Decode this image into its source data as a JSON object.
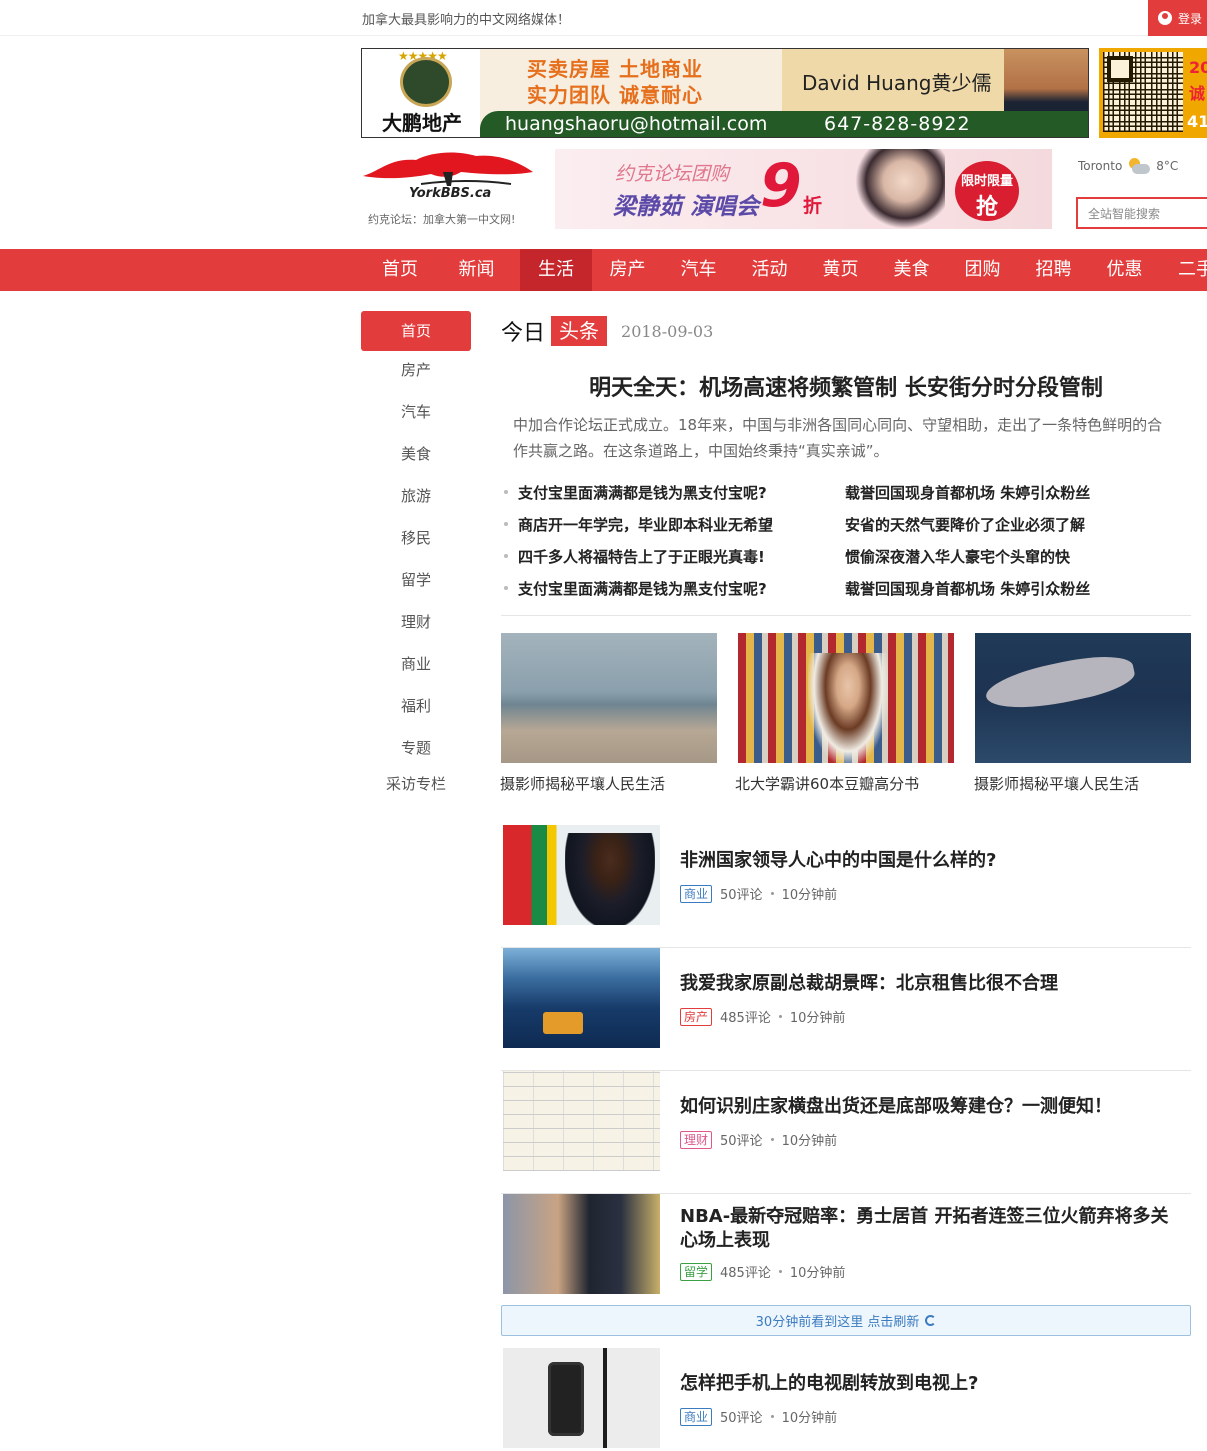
{
  "topbar": {
    "slogan": "加拿大最具影响力的中文网络媒体！",
    "login": "登录"
  },
  "banner_ad": {
    "brand": "大鹏地产",
    "slogan_line1": "买卖房屋 土地商业",
    "slogan_line2": "实力团队 诚意耐心",
    "agent": "David Huang黄少儒",
    "email": "huangshaoru@hotmail.com",
    "phone": "647-828-8922"
  },
  "side_ad": {
    "line1": "20",
    "line2": "诚",
    "line3": "41"
  },
  "site": {
    "tagline": "约克论坛：加拿大第一中文网!",
    "wordmark": "YorkBBS.ca"
  },
  "promo": {
    "line1": "约克论坛团购",
    "line2": "梁静茹 演唱会",
    "discount": "9",
    "discount_unit": "折",
    "badge_top": "限时限量",
    "badge_bottom": "抢"
  },
  "weather": {
    "city": "Toronto",
    "temp": "8°C"
  },
  "search": {
    "placeholder": "全站智能搜索"
  },
  "nav": {
    "items": [
      "首页",
      "新闻",
      "生活",
      "房产",
      "汽车",
      "活动",
      "黄页",
      "美食",
      "团购",
      "招聘",
      "优惠",
      "二手"
    ],
    "active": "生活"
  },
  "left_menu": {
    "items": [
      "首页",
      "房产",
      "汽车",
      "美食",
      "旅游",
      "移民",
      "留学",
      "理财",
      "商业",
      "福利",
      "专题",
      "采访专栏"
    ]
  },
  "headline_block": {
    "today": "今日",
    "toutiao": "头条",
    "date": "2018-09-03",
    "title": "明天全天：机场高速将频繁管制 长安街分时分段管制",
    "summary": "中加合作论坛正式成立。18年来，中国与非洲各国同心同向、守望相助，走出了一条特色鲜明的合作共赢之路。在这条道路上，中国始终秉持“真实亲诚”。",
    "links_left": [
      "支付宝里面满满都是钱为黑支付宝呢?",
      "商店开一年学完，毕业即本科业无希望",
      "四千多人将福特告上了于正眼光真毒!",
      "支付宝里面满满都是钱为黑支付宝呢?"
    ],
    "links_right": [
      "载誉回国现身首都机场 朱婷引众粉丝",
      "安省的天然气要降价了企业必须了解",
      "惯偷深夜潜入华人豪宅个头窜的快",
      "载誉回国现身首都机场 朱婷引众粉丝"
    ]
  },
  "photo_row": [
    {
      "caption": "摄影师揭秘平壤人民生活"
    },
    {
      "caption": "北大学霸讲60本豆瓣高分书"
    },
    {
      "caption": "摄影师揭秘平壤人民生活"
    }
  ],
  "feed": [
    {
      "title": "非洲国家领导人心中的中国是什么样的?",
      "tag": "商业",
      "tag_color": "#3b7bbf",
      "comments": "50评论",
      "time": "10分钟前"
    },
    {
      "title": "我爱我家原副总裁胡景晖：北京租售比很不合理",
      "tag": "房产",
      "tag_color": "#e33c3c",
      "comments": "485评论",
      "time": "10分钟前"
    },
    {
      "title": "如何识别庄家横盘出货还是底部吸筹建仓？一测便知！",
      "tag": "理财",
      "tag_color": "#e0588a",
      "comments": "50评论",
      "time": "10分钟前"
    },
    {
      "title": "NBA-最新夺冠赔率：勇士居首 开拓者连签三位火箭弃将多关心场上表现",
      "tag": "留学",
      "tag_color": "#3aa044",
      "comments": "485评论",
      "time": "10分钟前"
    },
    {
      "title": "怎样把手机上的电视剧转放到电视上?",
      "tag": "商业",
      "tag_color": "#3b7bbf",
      "comments": "50评论",
      "time": "10分钟前"
    }
  ],
  "refresh": {
    "label": "30分钟前看到这里 点击刷新"
  }
}
